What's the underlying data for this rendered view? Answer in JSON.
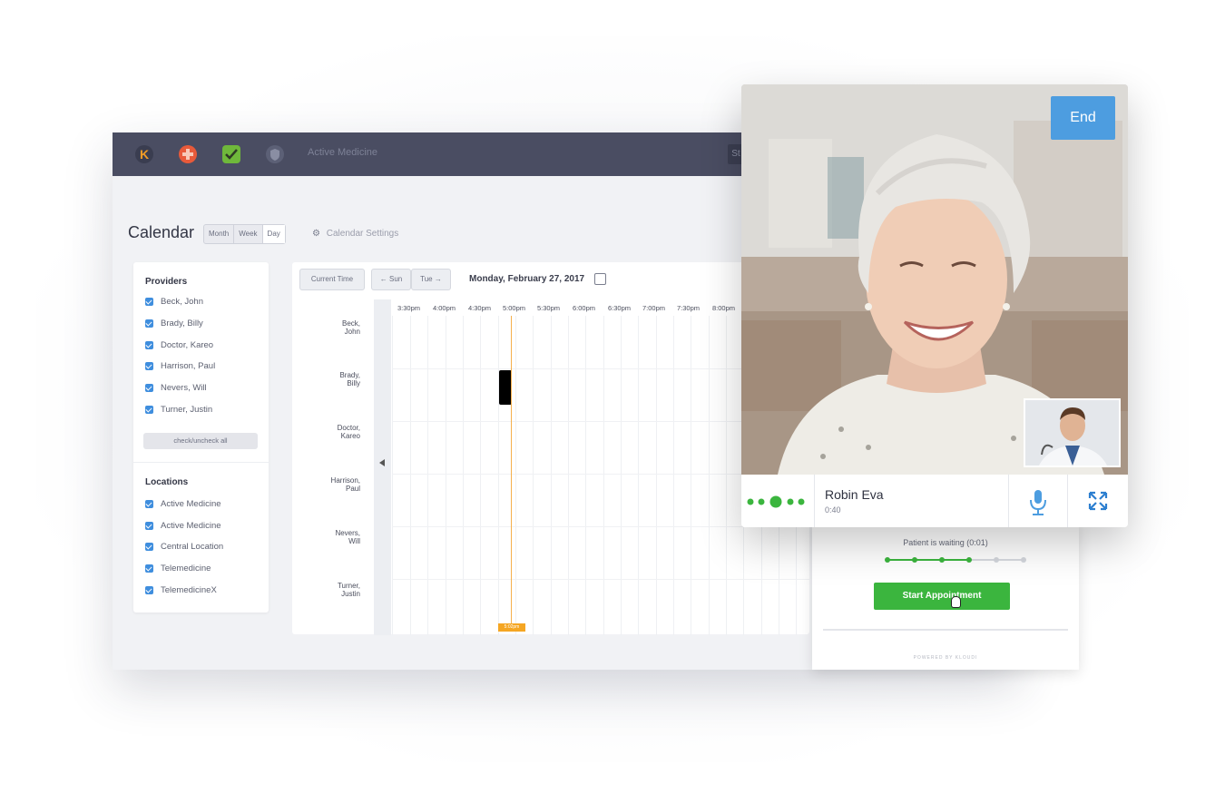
{
  "app": {
    "title": "Active Medicine",
    "topbar_right": "St"
  },
  "calendar": {
    "title": "Calendar",
    "views": [
      "Month",
      "Week",
      "Day"
    ],
    "active_view": "Day",
    "settings_label": "Calendar Settings"
  },
  "providers": {
    "heading": "Providers",
    "items": [
      "Beck, John",
      "Brady, Billy",
      "Doctor, Kareo",
      "Harrison, Paul",
      "Nevers, Will",
      "Turner, Justin"
    ],
    "check_all_label": "check/uncheck all"
  },
  "locations": {
    "heading": "Locations",
    "items": [
      "Active Medicine",
      "Active Medicine",
      "Central Location",
      "Telemedicine",
      "TelemedicineX"
    ]
  },
  "schedule": {
    "current_time_label": "Current Time",
    "prev_label": "← Sun",
    "next_label": "Tue →",
    "date": "Monday, February 27, 2017",
    "times": [
      "3:30pm",
      "4:00pm",
      "4:30pm",
      "5:00pm",
      "5:30pm",
      "6:00pm",
      "6:30pm",
      "7:00pm",
      "7:30pm",
      "8:00pm"
    ],
    "rows": [
      {
        "line1": "Beck,",
        "line2": "John"
      },
      {
        "line1": "Brady,",
        "line2": "Billy"
      },
      {
        "line1": "Doctor,",
        "line2": "Kareo"
      },
      {
        "line1": "Harrison,",
        "line2": "Paul"
      },
      {
        "line1": "Nevers,",
        "line2": "Will"
      },
      {
        "line1": "Turner,",
        "line2": "Justin"
      }
    ],
    "now_tag": "5:02pm"
  },
  "waiting": {
    "status": "Patient is waiting (0:01)",
    "progress_steps_total": 6,
    "progress_steps_done": 4,
    "start_label": "Start Appointment",
    "powered_by": "POWERED BY KLOUDI"
  },
  "video": {
    "end_label": "End",
    "caller_name": "Robin Eva",
    "call_timer": "0:40"
  },
  "colors": {
    "topbar": "#4a4d62",
    "checkbox": "#3f8ede",
    "start_green": "#3bb53e",
    "end_blue": "#4d9de0",
    "now_orange": "#f5a623"
  }
}
